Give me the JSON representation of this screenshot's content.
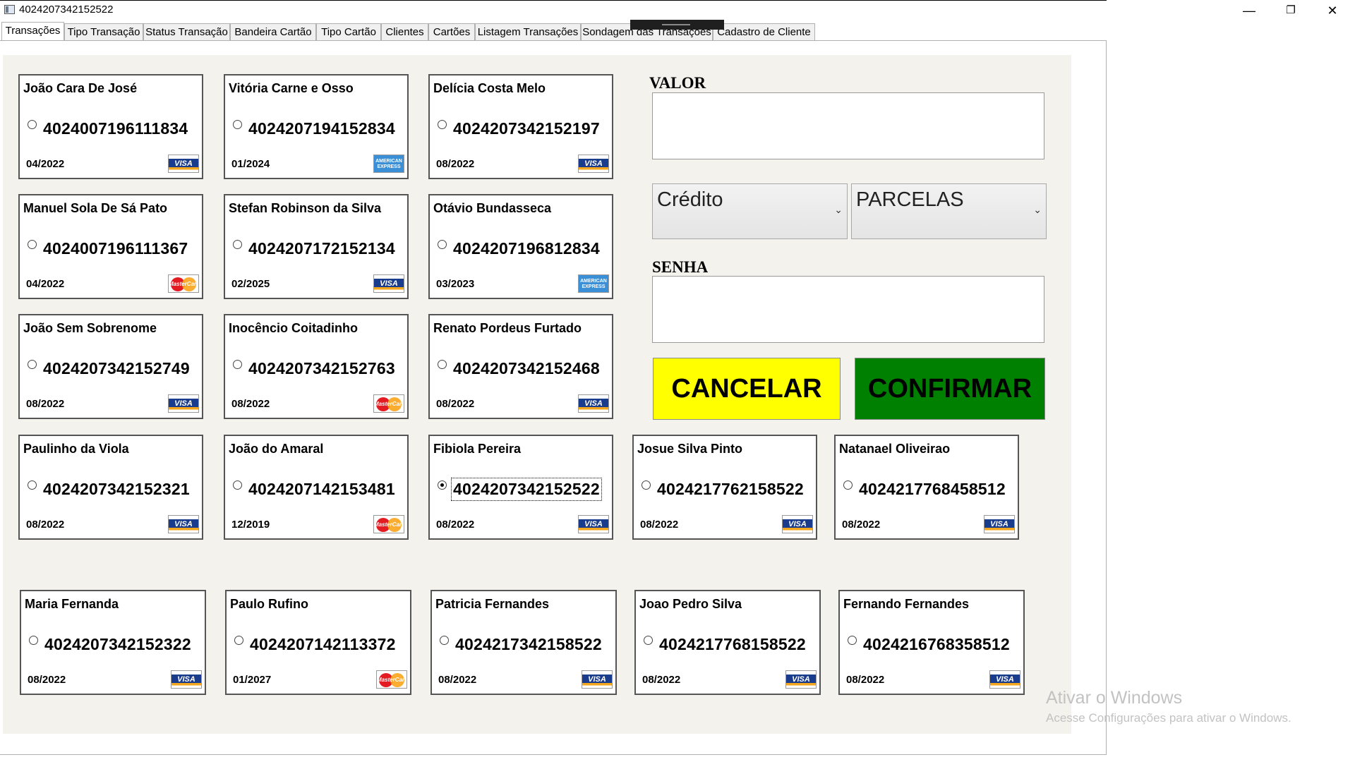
{
  "window": {
    "title": "4024207342152522",
    "minimize": "—",
    "restore": "❐",
    "close": "✕"
  },
  "tabs": [
    "Transações",
    "Tipo Transação",
    "Status Transação",
    "Bandeira Cartão",
    "Tipo Cartão",
    "Clientes",
    "Cartões",
    "Listagem Transações",
    "Sondagem das Transações",
    "Cadastro de Cliente"
  ],
  "cards": [
    {
      "name": "João Cara De José",
      "number": "4024007196111834",
      "expiry": "04/2022",
      "brand": "visa"
    },
    {
      "name": "Vitória Carne e Osso",
      "number": "4024207194152834",
      "expiry": "01/2024",
      "brand": "amex"
    },
    {
      "name": "Delícia Costa Melo",
      "number": "4024207342152197",
      "expiry": "08/2022",
      "brand": "visa"
    },
    {
      "name": "Manuel Sola De Sá Pato",
      "number": "4024007196111367",
      "expiry": "04/2022",
      "brand": "mastercard"
    },
    {
      "name": "Stefan Robinson da Silva",
      "number": "4024207172152134",
      "expiry": "02/2025",
      "brand": "visa"
    },
    {
      "name": "Otávio Bundasseca",
      "number": "4024207196812834",
      "expiry": "03/2023",
      "brand": "amex"
    },
    {
      "name": "João Sem Sobrenome",
      "number": "4024207342152749",
      "expiry": "08/2022",
      "brand": "visa"
    },
    {
      "name": "Inocêncio Coitadinho",
      "number": "4024207342152763",
      "expiry": "08/2022",
      "brand": "mastercard"
    },
    {
      "name": "Renato Pordeus Furtado",
      "number": "4024207342152468",
      "expiry": "08/2022",
      "brand": "visa"
    },
    {
      "name": "Paulinho da Viola",
      "number": "4024207342152321",
      "expiry": "08/2022",
      "brand": "visa"
    },
    {
      "name": "João do Amaral",
      "number": "4024207142153481",
      "expiry": "12/2019",
      "brand": "mastercard"
    },
    {
      "name": "Fibiola Pereira",
      "number": "4024207342152522",
      "expiry": "08/2022",
      "brand": "visa",
      "selected": true
    },
    {
      "name": "Josue Silva Pinto",
      "number": "4024217762158522",
      "expiry": "08/2022",
      "brand": "visa"
    },
    {
      "name": "Natanael Oliveirao",
      "number": "4024217768458512",
      "expiry": "08/2022",
      "brand": "visa"
    },
    {
      "name": "Maria Fernanda",
      "number": "4024207342152322",
      "expiry": "08/2022",
      "brand": "visa"
    },
    {
      "name": "Paulo Rufino",
      "number": "4024207142113372",
      "expiry": "01/2027",
      "brand": "mastercard"
    },
    {
      "name": "Patricia Fernandes",
      "number": "4024217342158522",
      "expiry": "08/2022",
      "brand": "visa"
    },
    {
      "name": "Joao Pedro Silva",
      "number": "4024217768158522",
      "expiry": "08/2022",
      "brand": "visa"
    },
    {
      "name": "Fernando Fernandes",
      "number": "4024216768358512",
      "expiry": "08/2022",
      "brand": "visa"
    }
  ],
  "brand_marks": {
    "visa": "VISA",
    "mastercard": "MasterCard",
    "amex": "AMERICAN EXPRESS"
  },
  "form": {
    "valor_label": "VALOR",
    "valor_value": "",
    "tipo_selected": "Crédito",
    "parcelas_selected": "PARCELAS",
    "senha_label": "SENHA",
    "senha_value": "",
    "cancel_label": "CANCELAR",
    "confirm_label": "CONFIRMAR",
    "cancel_color": "#ffff00",
    "confirm_color": "#008000"
  },
  "watermark": {
    "line1": "Ativar o Windows",
    "line2": "Acesse Configurações para ativar o Windows."
  }
}
